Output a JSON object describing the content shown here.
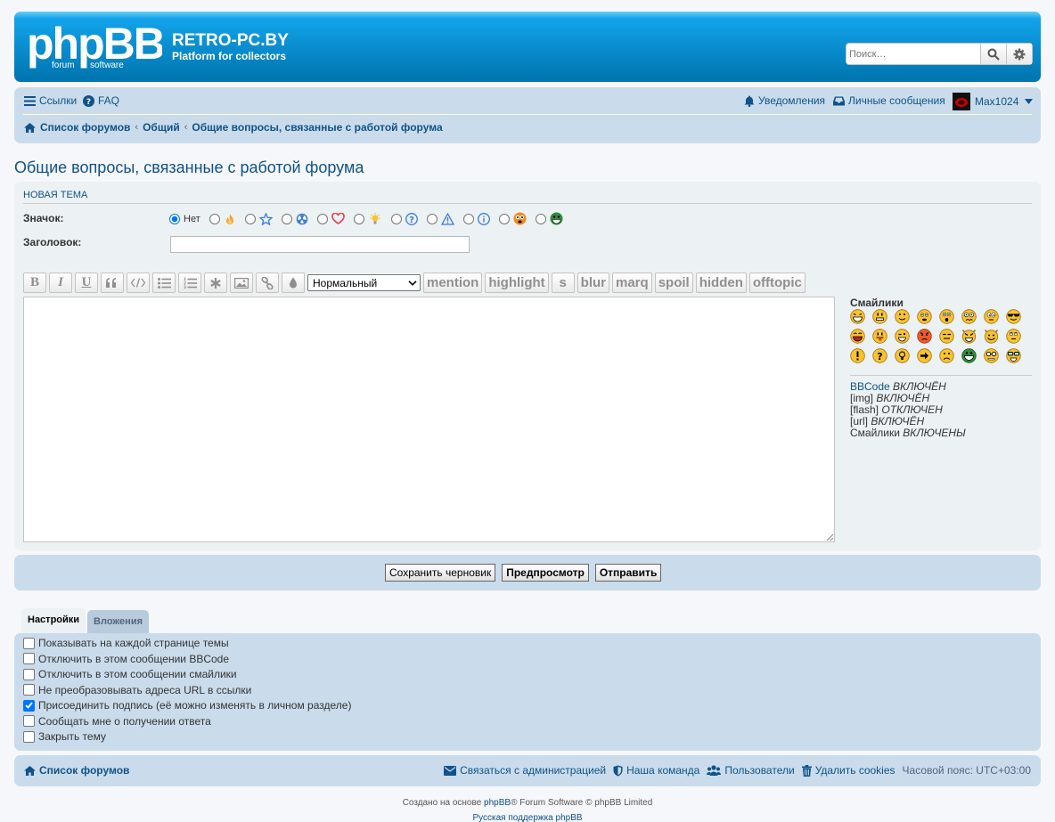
{
  "header": {
    "site_title": "RETRO-PC.BY",
    "site_desc": "Platform for collectors",
    "search_placeholder": "Поиск…"
  },
  "nav": {
    "links": "Ссылки",
    "faq": "FAQ",
    "notifications": "Уведомления",
    "messages": "Личные сообщения",
    "user": "Max1024"
  },
  "breadcrumbs": [
    "Список форумов",
    "Общий",
    "Общие вопросы, связанные с работой форума"
  ],
  "page_title": "Общие вопросы, связанные с работой форума",
  "form": {
    "section": "Новая тема",
    "icon_label": "Значок:",
    "no_icon": "Нет",
    "subject_label": "Заголовок:",
    "subject_value": "",
    "font_size": "Нормальный",
    "bbcode_buttons": [
      "mention",
      "highlight",
      "s",
      "blur",
      "marq",
      "spoil",
      "hidden",
      "offtopic"
    ]
  },
  "smilies": {
    "title": "Смайлики"
  },
  "bbinfo": {
    "bbcode": "BBCode",
    "bbcode_state": "ВКЛЮЧЁН",
    "img": "[img]",
    "img_state": "ВКЛЮЧЁН",
    "flash": "[flash]",
    "flash_state": "ОТКЛЮЧЕН",
    "url": "[url]",
    "url_state": "ВКЛЮЧЁН",
    "smilies": "Смайлики",
    "smilies_state": "ВКЛЮЧЕНЫ"
  },
  "buttons": {
    "save": "Сохранить черновик",
    "preview": "Предпросмотр",
    "submit": "Отправить"
  },
  "tabs": [
    "Настройки",
    "Вложения"
  ],
  "options": [
    {
      "label": "Показывать на каждой странице темы",
      "checked": false
    },
    {
      "label": "Отключить в этом сообщении BBCode",
      "checked": false
    },
    {
      "label": "Отключить в этом сообщении смайлики",
      "checked": false
    },
    {
      "label": "Не преобразовывать адреса URL в ссылки",
      "checked": false
    },
    {
      "label": "Присоединить подпись (её можно изменять в личном разделе)",
      "checked": true
    },
    {
      "label": "Сообщать мне о получении ответа",
      "checked": false
    },
    {
      "label": "Закрыть тему",
      "checked": false
    }
  ],
  "footer": {
    "index": "Список форумов",
    "contact": "Связаться с администрацией",
    "team": "Наша команда",
    "members": "Пользователи",
    "cookies": "Удалить cookies",
    "timezone": "Часовой пояс: UTC+03:00",
    "credit_pre": "Создано на основе ",
    "credit_link": "phpBB",
    "credit_post": "® Forum Software © phpBB Limited",
    "support": "Русская поддержка phpBB"
  },
  "colors": {
    "link": "#105289",
    "header_blue": "#0076b1",
    "panel": "#cadceb",
    "bg": "#ecf1f3"
  }
}
